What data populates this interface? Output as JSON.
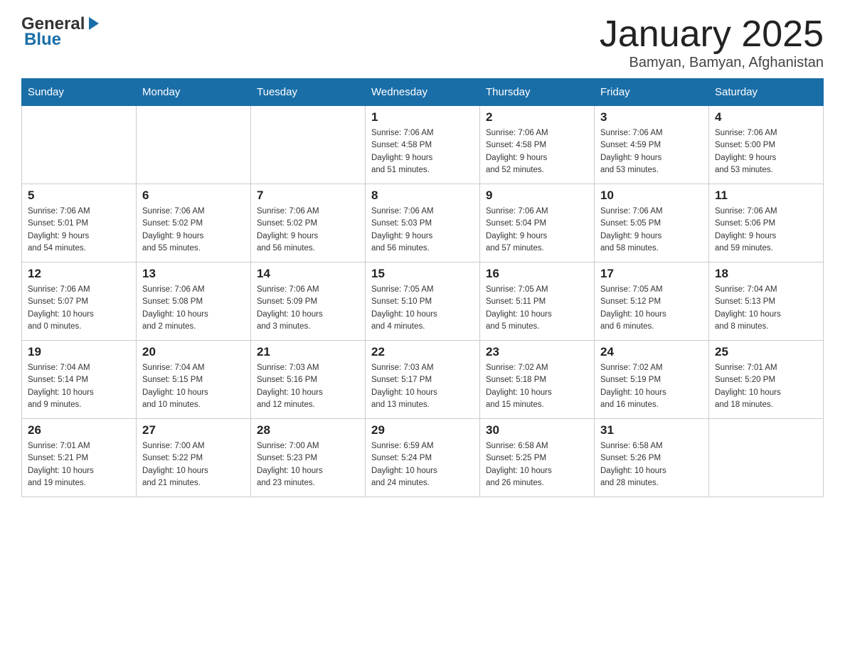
{
  "logo": {
    "general": "General",
    "blue": "Blue",
    "arrow": "▶"
  },
  "title": "January 2025",
  "subtitle": "Bamyan, Bamyan, Afghanistan",
  "days_header": [
    "Sunday",
    "Monday",
    "Tuesday",
    "Wednesday",
    "Thursday",
    "Friday",
    "Saturday"
  ],
  "weeks": [
    [
      {
        "day": "",
        "info": ""
      },
      {
        "day": "",
        "info": ""
      },
      {
        "day": "",
        "info": ""
      },
      {
        "day": "1",
        "info": "Sunrise: 7:06 AM\nSunset: 4:58 PM\nDaylight: 9 hours\nand 51 minutes."
      },
      {
        "day": "2",
        "info": "Sunrise: 7:06 AM\nSunset: 4:58 PM\nDaylight: 9 hours\nand 52 minutes."
      },
      {
        "day": "3",
        "info": "Sunrise: 7:06 AM\nSunset: 4:59 PM\nDaylight: 9 hours\nand 53 minutes."
      },
      {
        "day": "4",
        "info": "Sunrise: 7:06 AM\nSunset: 5:00 PM\nDaylight: 9 hours\nand 53 minutes."
      }
    ],
    [
      {
        "day": "5",
        "info": "Sunrise: 7:06 AM\nSunset: 5:01 PM\nDaylight: 9 hours\nand 54 minutes."
      },
      {
        "day": "6",
        "info": "Sunrise: 7:06 AM\nSunset: 5:02 PM\nDaylight: 9 hours\nand 55 minutes."
      },
      {
        "day": "7",
        "info": "Sunrise: 7:06 AM\nSunset: 5:02 PM\nDaylight: 9 hours\nand 56 minutes."
      },
      {
        "day": "8",
        "info": "Sunrise: 7:06 AM\nSunset: 5:03 PM\nDaylight: 9 hours\nand 56 minutes."
      },
      {
        "day": "9",
        "info": "Sunrise: 7:06 AM\nSunset: 5:04 PM\nDaylight: 9 hours\nand 57 minutes."
      },
      {
        "day": "10",
        "info": "Sunrise: 7:06 AM\nSunset: 5:05 PM\nDaylight: 9 hours\nand 58 minutes."
      },
      {
        "day": "11",
        "info": "Sunrise: 7:06 AM\nSunset: 5:06 PM\nDaylight: 9 hours\nand 59 minutes."
      }
    ],
    [
      {
        "day": "12",
        "info": "Sunrise: 7:06 AM\nSunset: 5:07 PM\nDaylight: 10 hours\nand 0 minutes."
      },
      {
        "day": "13",
        "info": "Sunrise: 7:06 AM\nSunset: 5:08 PM\nDaylight: 10 hours\nand 2 minutes."
      },
      {
        "day": "14",
        "info": "Sunrise: 7:06 AM\nSunset: 5:09 PM\nDaylight: 10 hours\nand 3 minutes."
      },
      {
        "day": "15",
        "info": "Sunrise: 7:05 AM\nSunset: 5:10 PM\nDaylight: 10 hours\nand 4 minutes."
      },
      {
        "day": "16",
        "info": "Sunrise: 7:05 AM\nSunset: 5:11 PM\nDaylight: 10 hours\nand 5 minutes."
      },
      {
        "day": "17",
        "info": "Sunrise: 7:05 AM\nSunset: 5:12 PM\nDaylight: 10 hours\nand 6 minutes."
      },
      {
        "day": "18",
        "info": "Sunrise: 7:04 AM\nSunset: 5:13 PM\nDaylight: 10 hours\nand 8 minutes."
      }
    ],
    [
      {
        "day": "19",
        "info": "Sunrise: 7:04 AM\nSunset: 5:14 PM\nDaylight: 10 hours\nand 9 minutes."
      },
      {
        "day": "20",
        "info": "Sunrise: 7:04 AM\nSunset: 5:15 PM\nDaylight: 10 hours\nand 10 minutes."
      },
      {
        "day": "21",
        "info": "Sunrise: 7:03 AM\nSunset: 5:16 PM\nDaylight: 10 hours\nand 12 minutes."
      },
      {
        "day": "22",
        "info": "Sunrise: 7:03 AM\nSunset: 5:17 PM\nDaylight: 10 hours\nand 13 minutes."
      },
      {
        "day": "23",
        "info": "Sunrise: 7:02 AM\nSunset: 5:18 PM\nDaylight: 10 hours\nand 15 minutes."
      },
      {
        "day": "24",
        "info": "Sunrise: 7:02 AM\nSunset: 5:19 PM\nDaylight: 10 hours\nand 16 minutes."
      },
      {
        "day": "25",
        "info": "Sunrise: 7:01 AM\nSunset: 5:20 PM\nDaylight: 10 hours\nand 18 minutes."
      }
    ],
    [
      {
        "day": "26",
        "info": "Sunrise: 7:01 AM\nSunset: 5:21 PM\nDaylight: 10 hours\nand 19 minutes."
      },
      {
        "day": "27",
        "info": "Sunrise: 7:00 AM\nSunset: 5:22 PM\nDaylight: 10 hours\nand 21 minutes."
      },
      {
        "day": "28",
        "info": "Sunrise: 7:00 AM\nSunset: 5:23 PM\nDaylight: 10 hours\nand 23 minutes."
      },
      {
        "day": "29",
        "info": "Sunrise: 6:59 AM\nSunset: 5:24 PM\nDaylight: 10 hours\nand 24 minutes."
      },
      {
        "day": "30",
        "info": "Sunrise: 6:58 AM\nSunset: 5:25 PM\nDaylight: 10 hours\nand 26 minutes."
      },
      {
        "day": "31",
        "info": "Sunrise: 6:58 AM\nSunset: 5:26 PM\nDaylight: 10 hours\nand 28 minutes."
      },
      {
        "day": "",
        "info": ""
      }
    ]
  ]
}
